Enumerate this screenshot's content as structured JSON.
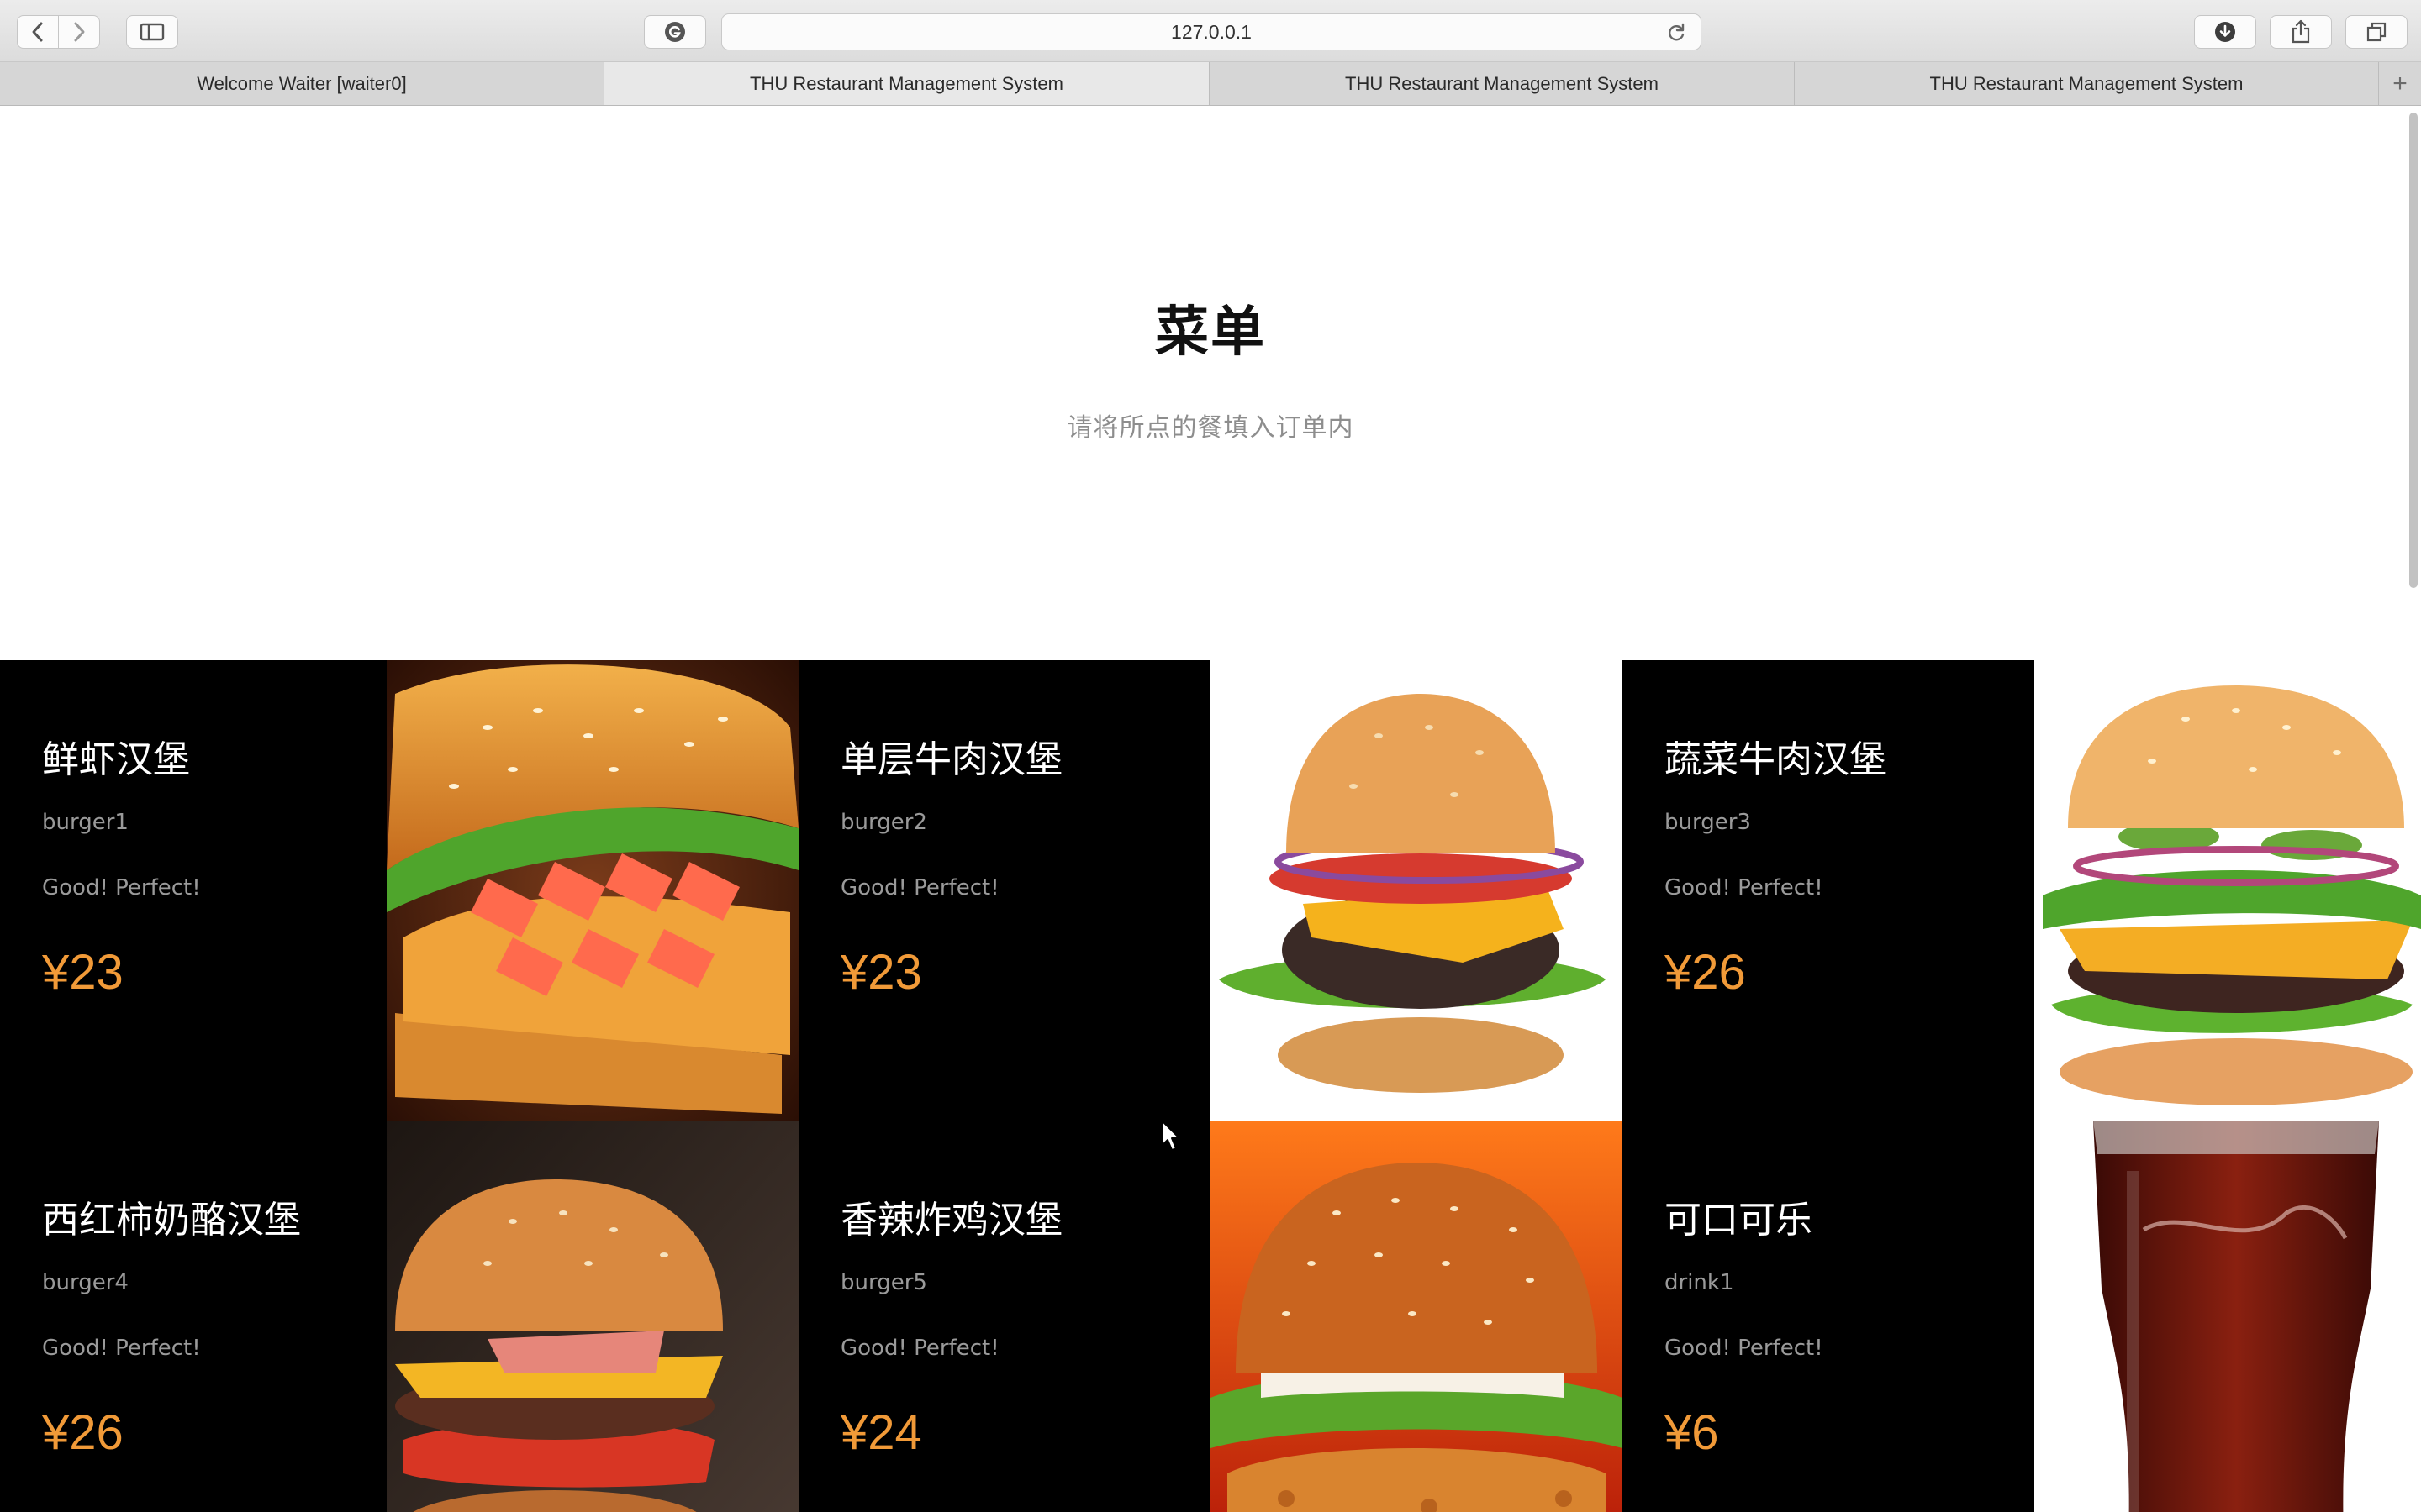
{
  "browser": {
    "url": "127.0.0.1",
    "tabs": [
      {
        "label": "Welcome Waiter [waiter0]",
        "active": false
      },
      {
        "label": "THU Restaurant Management System",
        "active": true
      },
      {
        "label": "THU Restaurant Management System",
        "active": false
      },
      {
        "label": "THU Restaurant Management System",
        "active": false
      }
    ],
    "new_tab_label": "+"
  },
  "page": {
    "title": "菜单",
    "subtitle": "请将所点的餐填入订单内"
  },
  "menu": {
    "items": [
      {
        "name": "鲜虾汉堡",
        "code": "burger1",
        "desc": "Good! Perfect!",
        "price": "¥23"
      },
      {
        "name": "单层牛肉汉堡",
        "code": "burger2",
        "desc": "Good! Perfect!",
        "price": "¥23"
      },
      {
        "name": "蔬菜牛肉汉堡",
        "code": "burger3",
        "desc": "Good! Perfect!",
        "price": "¥26"
      },
      {
        "name": "西红柿奶酪汉堡",
        "code": "burger4",
        "desc": "Good! Perfect!",
        "price": "¥26"
      },
      {
        "name": "香辣炸鸡汉堡",
        "code": "burger5",
        "desc": "Good! Perfect!",
        "price": "¥24"
      },
      {
        "name": "可口可乐",
        "code": "drink1",
        "desc": "Good! Perfect!",
        "price": "¥6"
      }
    ]
  },
  "colors": {
    "price": "#f19a38",
    "card_bg": "#000000",
    "subtitle": "#8d8d8d"
  }
}
